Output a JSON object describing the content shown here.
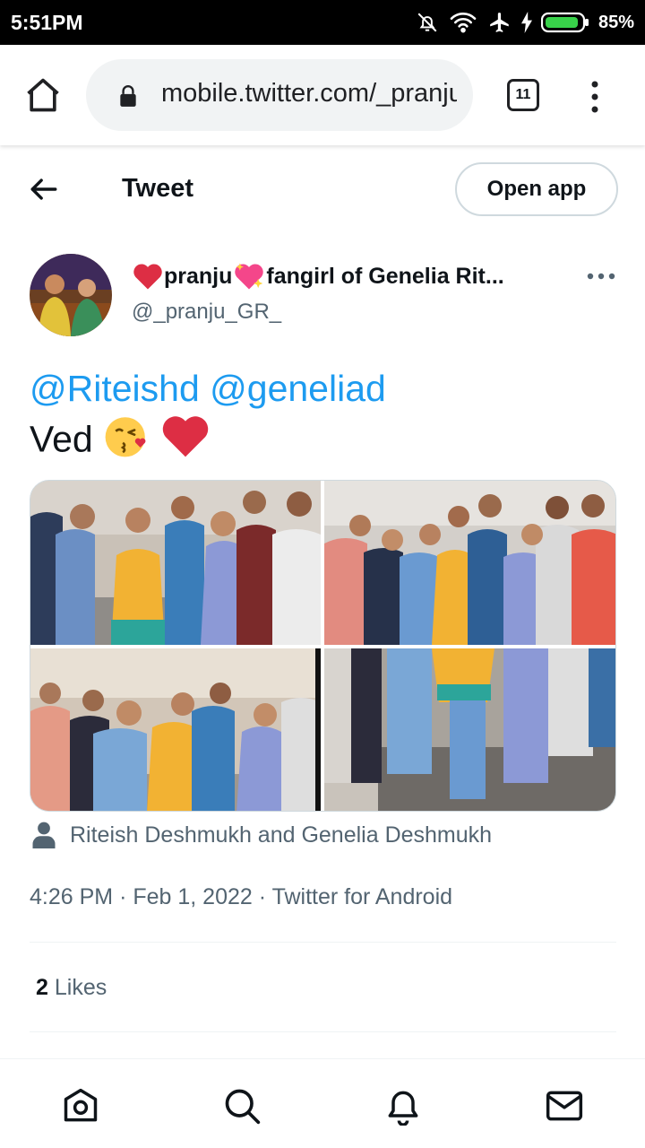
{
  "status_bar": {
    "time": "5:51PM",
    "battery": "85%"
  },
  "browser": {
    "url": "mobile.twitter.com/_pranju_GR_",
    "tab_count": "11"
  },
  "header": {
    "title": "Tweet",
    "open_app_label": "Open app"
  },
  "tweet": {
    "author_name": "pranju",
    "author_name_rest": "fangirl of Genelia Rit...",
    "author_handle": "@_pranju_GR_",
    "mention_1": "@Riteishd",
    "mention_2": "@geneliad",
    "text": "Ved",
    "tagged_people": "Riteish Deshmukh and Genelia Deshmukh",
    "time": "4:26 PM",
    "date": "Feb 1, 2022",
    "source": "Twitter for Android",
    "likes_count": "2",
    "likes_label": "Likes"
  },
  "colors": {
    "accent": "#1d9bf0",
    "text": "#0f1419",
    "secondary": "#536471"
  },
  "icons": {
    "status": [
      "notifications-off-icon",
      "wifi-icon",
      "airplane-icon",
      "charging-icon",
      "battery-icon"
    ],
    "browser": [
      "home-icon",
      "lock-icon",
      "tabs-icon",
      "more-vert-icon"
    ],
    "bottom_nav": [
      "home-icon",
      "search-icon",
      "notifications-icon",
      "messages-icon"
    ]
  }
}
